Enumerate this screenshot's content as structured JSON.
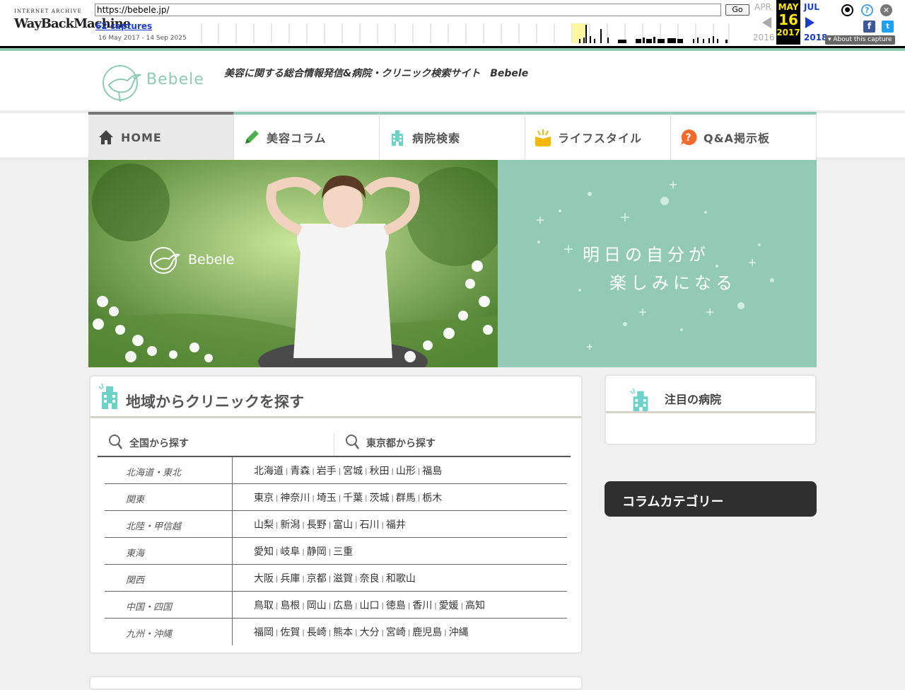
{
  "wayback": {
    "logo_top": "INTERNET ARCHIVE",
    "logo_a": "WayBack",
    "logo_b": "Machine",
    "url": "https://bebele.jp/",
    "go_label": "Go",
    "captures": "62 captures",
    "range": "16 May 2017 - 14 Sep 2025",
    "prev_month": "APR",
    "prev_year": "2016",
    "cur_month": "MAY",
    "cur_day": "16",
    "cur_year": "2017",
    "next_month": "JUL",
    "next_year": "2018",
    "about": "About this capture",
    "colors": {
      "highlight": "#ffe800",
      "link": "#1a3ec8"
    }
  },
  "site": {
    "logo_text": "Bebele",
    "tagline": "美容に関する総合情報発信&病院・クリニック検索サイト　Bebele",
    "accent": "#8fcbb3"
  },
  "nav": [
    {
      "label": "HOME",
      "icon": "home-icon"
    },
    {
      "label": "美容コラム",
      "icon": "pencil-icon"
    },
    {
      "label": "病院検索",
      "icon": "hospital-icon"
    },
    {
      "label": "ライフスタイル",
      "icon": "book-icon"
    },
    {
      "label": "Q&A掲示板",
      "icon": "question-bubble-icon"
    }
  ],
  "hero": {
    "logo_text": "Bebele",
    "line1": "明日の自分が",
    "line2": "楽しみになる"
  },
  "clinic_search": {
    "title": "地域からクリニックを探す",
    "tab_national": "全国から探す",
    "tab_tokyo": "東京都から探す",
    "regions": [
      {
        "name": "北海道・東北",
        "prefs": [
          "北海道",
          "青森",
          "岩手",
          "宮城",
          "秋田",
          "山形",
          "福島"
        ]
      },
      {
        "name": "関東",
        "prefs": [
          "東京",
          "神奈川",
          "埼玉",
          "千葉",
          "茨城",
          "群馬",
          "栃木"
        ]
      },
      {
        "name": "北陸・甲信越",
        "prefs": [
          "山梨",
          "新潟",
          "長野",
          "富山",
          "石川",
          "福井"
        ]
      },
      {
        "name": "東海",
        "prefs": [
          "愛知",
          "岐阜",
          "静岡",
          "三重"
        ]
      },
      {
        "name": "関西",
        "prefs": [
          "大阪",
          "兵庫",
          "京都",
          "滋賀",
          "奈良",
          "和歌山"
        ]
      },
      {
        "name": "中国・四国",
        "prefs": [
          "鳥取",
          "島根",
          "岡山",
          "広島",
          "山口",
          "徳島",
          "香川",
          "愛媛",
          "高知"
        ]
      },
      {
        "name": "九州・沖縄",
        "prefs": [
          "福岡",
          "佐賀",
          "長崎",
          "熊本",
          "大分",
          "宮崎",
          "鹿児島",
          "沖縄"
        ]
      }
    ]
  },
  "featured": {
    "title": "注目の病院"
  },
  "column_category": {
    "title": "コラムカテゴリー"
  }
}
